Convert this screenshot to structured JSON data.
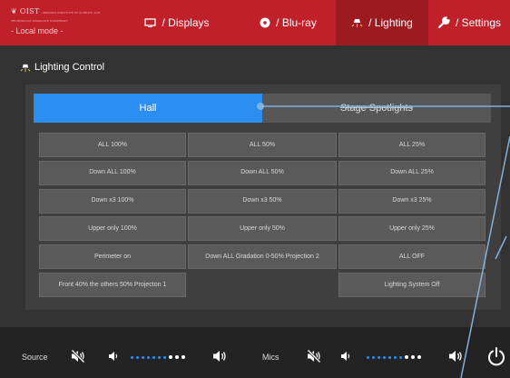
{
  "header": {
    "brand_name": "OIST",
    "brand_sub": "OKINAWA INSTITUTE OF SCIENCE AND TECHNOLOGY GRADUATE UNIVERSITY",
    "mode": "- Local mode -",
    "tabs": [
      {
        "label": "/ Displays",
        "icon": "display-icon"
      },
      {
        "label": "/ Blu-ray",
        "icon": "disc-icon"
      },
      {
        "label": "/ Lighting",
        "icon": "lamp-icon",
        "active": true
      },
      {
        "label": "/ Settings",
        "icon": "wrench-icon"
      }
    ]
  },
  "section": {
    "title": "Lighting Control",
    "icon": "lamp-icon"
  },
  "segments": {
    "hall": "Hall",
    "stage": "Stage Spotlights",
    "selected": "Hall"
  },
  "presets": [
    [
      "ALL 100%",
      "ALL 50%",
      "ALL 25%"
    ],
    [
      "Down ALL 100%",
      "Down ALL 50%",
      "Down ALL 25%"
    ],
    [
      "Down x3 100%",
      "Down x3 50%",
      "Down x3 25%"
    ],
    [
      "Upper only 100%",
      "Upper only 50%",
      "Upper only 25%"
    ],
    [
      "Perimeter on",
      "Down ALL Gradation 0-50% Projection 2",
      "ALL OFF"
    ],
    [
      "Front 40% the others 50% Projecton 1",
      "",
      "Lighting System Off"
    ]
  ],
  "footer": {
    "source_label": "Source",
    "mics_label": "Mics",
    "source_volume_level": 0.7,
    "mics_volume_level": 0.7
  },
  "colors": {
    "header": "#c0202a",
    "active_tab": "#9d1a21",
    "accent": "#2b8ef0"
  }
}
